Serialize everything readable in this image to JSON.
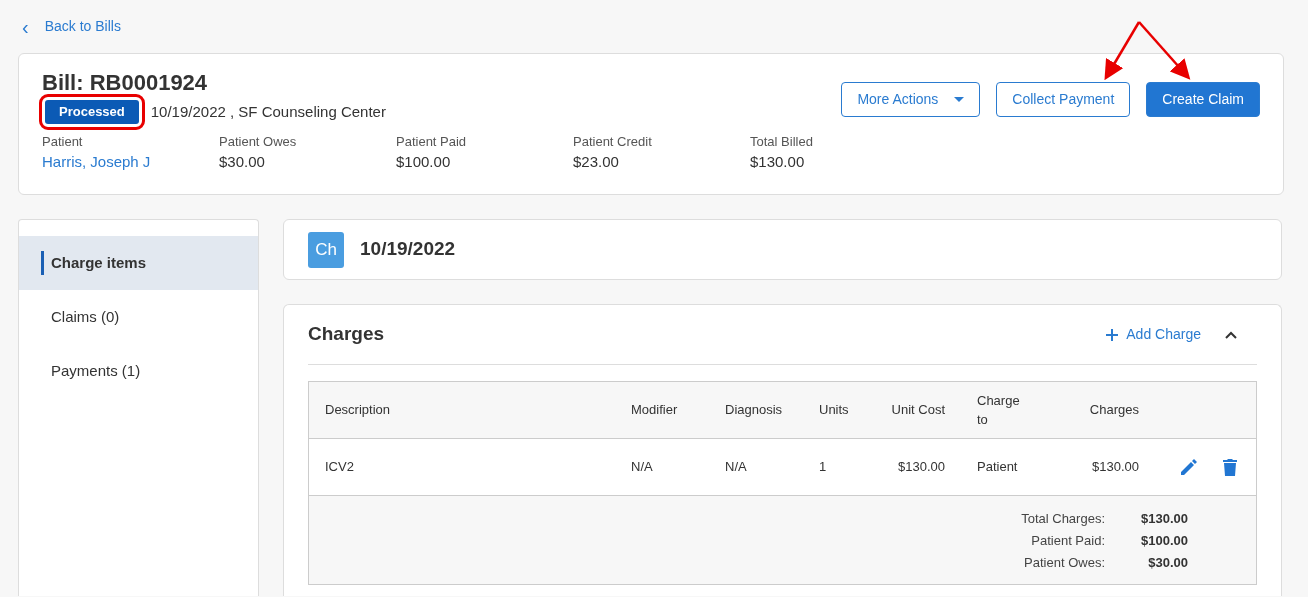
{
  "back_link": {
    "icon": "‹",
    "label": "Back to Bills"
  },
  "bill": {
    "title": "Bill: RB0001924",
    "status": "Processed",
    "highlighted": true,
    "meta": "10/19/2022 , SF Counseling Center",
    "fields": [
      {
        "label": "Patient",
        "value": "Harris, Joseph J",
        "kind": "link"
      },
      {
        "label": "Patient Owes",
        "value": "$30.00",
        "kind": "text"
      },
      {
        "label": "Patient Paid",
        "value": "$100.00",
        "kind": "text"
      },
      {
        "label": "Patient Credit",
        "value": "$23.00",
        "kind": "text"
      },
      {
        "label": "Total Billed",
        "value": "$130.00",
        "kind": "text"
      }
    ],
    "actions": [
      {
        "label": "More Actions",
        "kind": "dropdown",
        "pointed": false
      },
      {
        "label": "Collect Payment",
        "kind": "outline",
        "pointed": true
      },
      {
        "label": "Create Claim",
        "kind": "primary",
        "pointed": true
      }
    ]
  },
  "sidebar": {
    "items": [
      {
        "label": "Charge items",
        "selected": true
      },
      {
        "label": "Claims (0)",
        "selected": false
      },
      {
        "label": "Payments (1)",
        "selected": false
      }
    ]
  },
  "encounter": {
    "avatar": "Ch",
    "date": "10/19/2022"
  },
  "charges": {
    "title": "Charges",
    "add_label": "Add Charge",
    "expanded": true,
    "table": {
      "columns": [
        "Description",
        "Modifier",
        "Diagnosis",
        "Units",
        "Unit Cost",
        "Charge to",
        "Charges"
      ],
      "rows": [
        [
          "ICV2",
          "N/A",
          "N/A",
          "1",
          "$130.00",
          "Patient",
          "$130.00"
        ]
      ]
    },
    "totals": [
      {
        "label": "Total Charges:",
        "value": "$130.00"
      },
      {
        "label": "Patient Paid:",
        "value": "$100.00"
      },
      {
        "label": "Patient Owes:",
        "value": "$30.00"
      }
    ]
  }
}
